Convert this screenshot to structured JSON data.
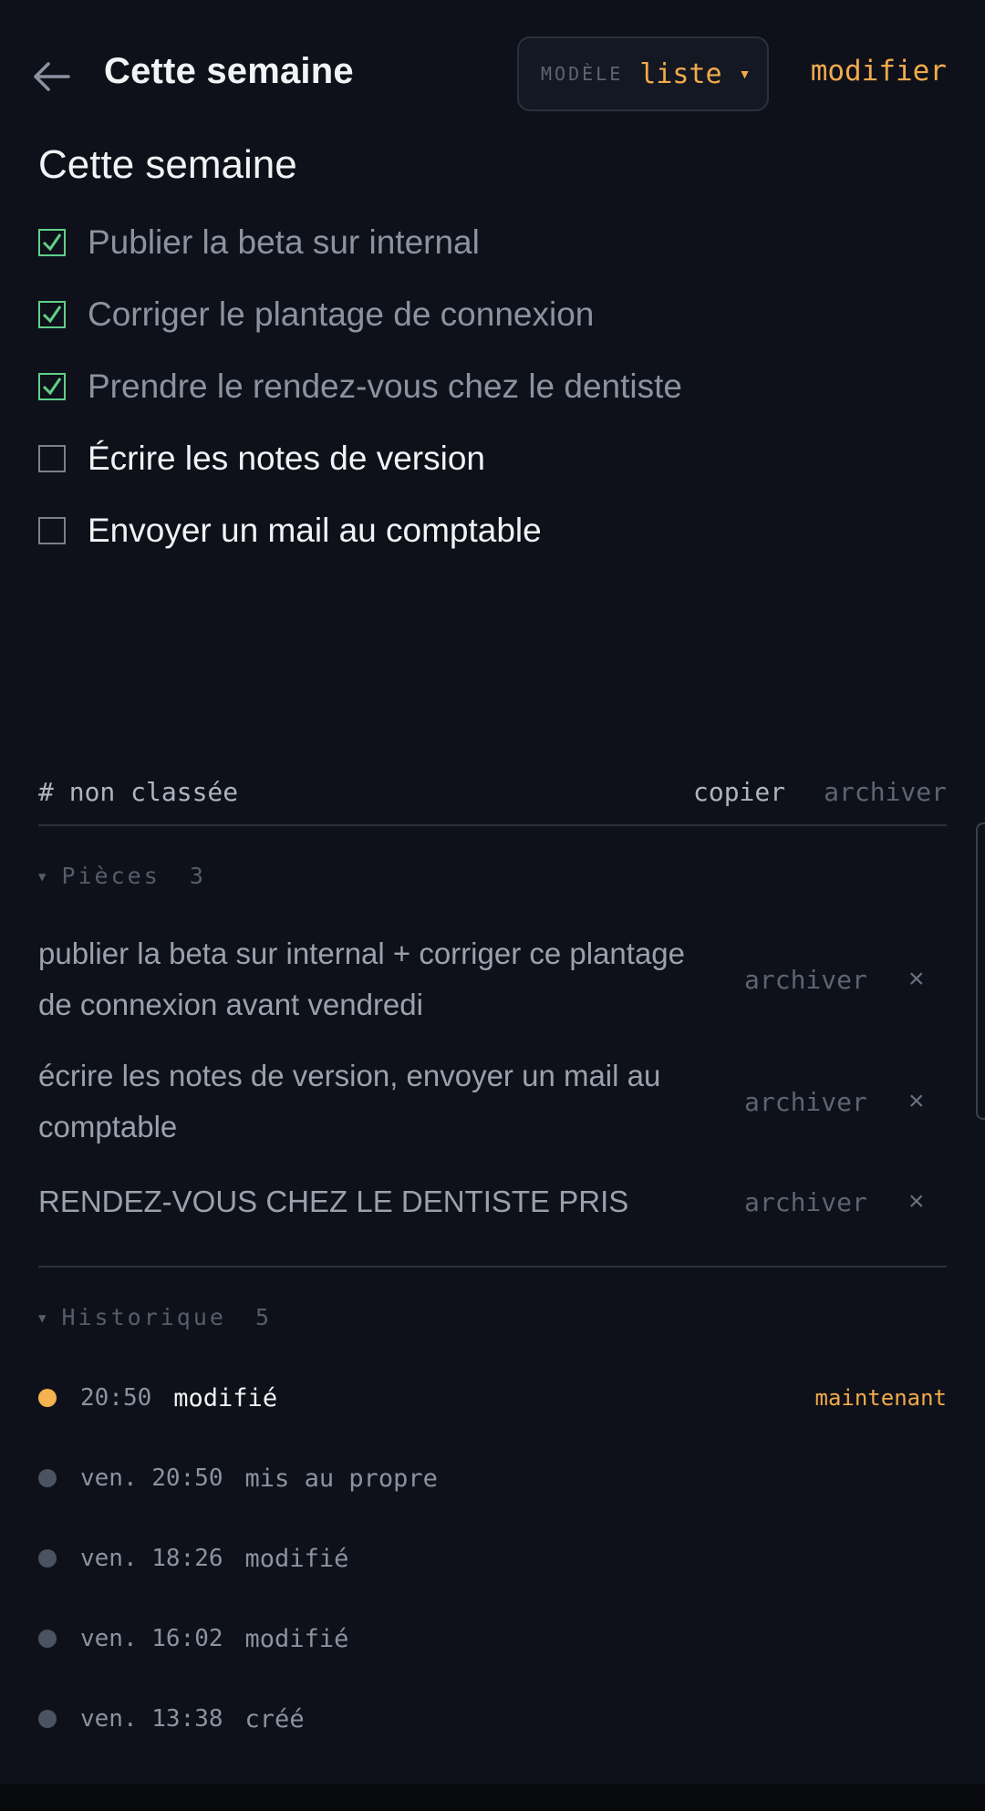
{
  "header": {
    "title": "Cette semaine",
    "model_label": "MODÈLE",
    "model_value": "liste",
    "edit_label": "modifier"
  },
  "note": {
    "title": "Cette semaine",
    "items": [
      {
        "text": "Publier la beta sur internal",
        "checked": true
      },
      {
        "text": "Corriger le plantage de connexion",
        "checked": true
      },
      {
        "text": "Prendre le rendez-vous chez le dentiste",
        "checked": true
      },
      {
        "text": "Écrire les notes de version",
        "checked": false
      },
      {
        "text": "Envoyer un mail au comptable",
        "checked": false
      }
    ]
  },
  "section": {
    "name": "# non classée",
    "copy_label": "copier",
    "archive_label": "archiver"
  },
  "pieces": {
    "label": "Pièces",
    "count": "3",
    "items": [
      {
        "text": "publier la beta sur internal + corriger ce plantage de connexion avant vendredi",
        "archive": "archiver",
        "close": "×"
      },
      {
        "text": "écrire les notes de version, envoyer un mail au comptable",
        "archive": "archiver",
        "close": "×"
      },
      {
        "text": "RENDEZ-VOUS CHEZ LE DENTISTE PRIS",
        "archive": "archiver",
        "close": "×"
      }
    ]
  },
  "history": {
    "label": "Historique",
    "count": "5",
    "items": [
      {
        "time": "20:50",
        "action": "modifié",
        "badge": "maintenant"
      },
      {
        "time": "ven. 20:50",
        "action": "mis au propre"
      },
      {
        "time": "ven. 18:26",
        "action": "modifié"
      },
      {
        "time": "ven. 16:02",
        "action": "modifié"
      },
      {
        "time": "ven. 13:38",
        "action": "créé"
      }
    ]
  },
  "colors": {
    "background": "#0e1119",
    "accent": "#f2aa4c",
    "check": "#5fd08a"
  }
}
